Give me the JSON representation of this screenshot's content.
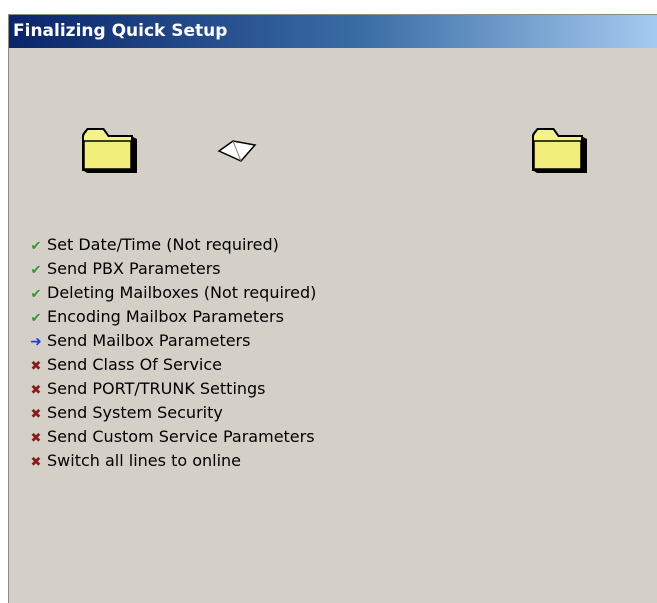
{
  "title": "Finalizing Quick Setup",
  "colors": {
    "title_start": "#0a246a",
    "title_end": "#a6caf0",
    "background": "#d4d0c8",
    "done": "#2e9a2e",
    "current": "#1f3fd6",
    "pending": "#8b1a1a"
  },
  "animation": {
    "source_icon": "folder-icon",
    "document_icon": "flying-document-icon",
    "destination_icon": "folder-icon"
  },
  "steps": [
    {
      "label": "Set Date/Time (Not required)",
      "status": "done",
      "icon": "checkmark-icon",
      "glyph": "✔"
    },
    {
      "label": "Send PBX Parameters",
      "status": "done",
      "icon": "checkmark-icon",
      "glyph": "✔"
    },
    {
      "label": "Deleting Mailboxes (Not required)",
      "status": "done",
      "icon": "checkmark-icon",
      "glyph": "✔"
    },
    {
      "label": "Encoding Mailbox Parameters",
      "status": "done",
      "icon": "checkmark-icon",
      "glyph": "✔"
    },
    {
      "label": "Send Mailbox Parameters",
      "status": "current",
      "icon": "arrow-right-icon",
      "glyph": "➜"
    },
    {
      "label": "Send Class Of Service",
      "status": "pending",
      "icon": "x-mark-icon",
      "glyph": "✖"
    },
    {
      "label": "Send PORT/TRUNK Settings",
      "status": "pending",
      "icon": "x-mark-icon",
      "glyph": "✖"
    },
    {
      "label": "Send System Security",
      "status": "pending",
      "icon": "x-mark-icon",
      "glyph": "✖"
    },
    {
      "label": "Send Custom Service Parameters",
      "status": "pending",
      "icon": "x-mark-icon",
      "glyph": "✖"
    },
    {
      "label": "Switch all lines to online",
      "status": "pending",
      "icon": "x-mark-icon",
      "glyph": "✖"
    }
  ]
}
